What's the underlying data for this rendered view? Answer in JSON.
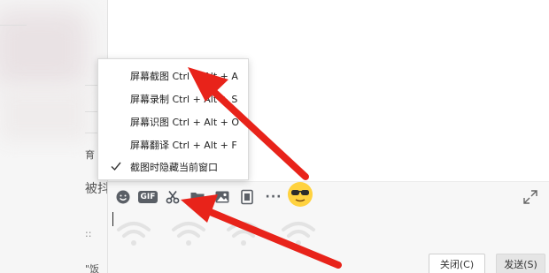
{
  "left_panel": {
    "fragments": [
      "育",
      "被抖",
      "::",
      "\"饭"
    ]
  },
  "menu": {
    "items": [
      {
        "label": "屏幕截图 Ctrl + Alt + A",
        "checked": false
      },
      {
        "label": "屏幕录制 Ctrl + Alt + S",
        "checked": false
      },
      {
        "label": "屏幕识图 Ctrl + Alt + O",
        "checked": false
      },
      {
        "label": "屏幕翻译 Ctrl + Alt + F",
        "checked": false
      },
      {
        "label": "截图时隐藏当前窗口",
        "checked": true
      }
    ]
  },
  "toolbar": {
    "icons": [
      "emoji-icon",
      "gif-icon",
      "scissors-icon",
      "folder-icon",
      "image-icon",
      "screen-record-icon",
      "more-icon",
      "sunglasses-emoji-icon"
    ],
    "gif_label": "GIF",
    "more_label": "···"
  },
  "buttons": {
    "close_label": "关闭(C)",
    "send_label": "发送(S)"
  },
  "colors": {
    "arrow": "#e8231a",
    "menu_bg": "#ffffff",
    "input_bg": "#f7f7f7"
  }
}
